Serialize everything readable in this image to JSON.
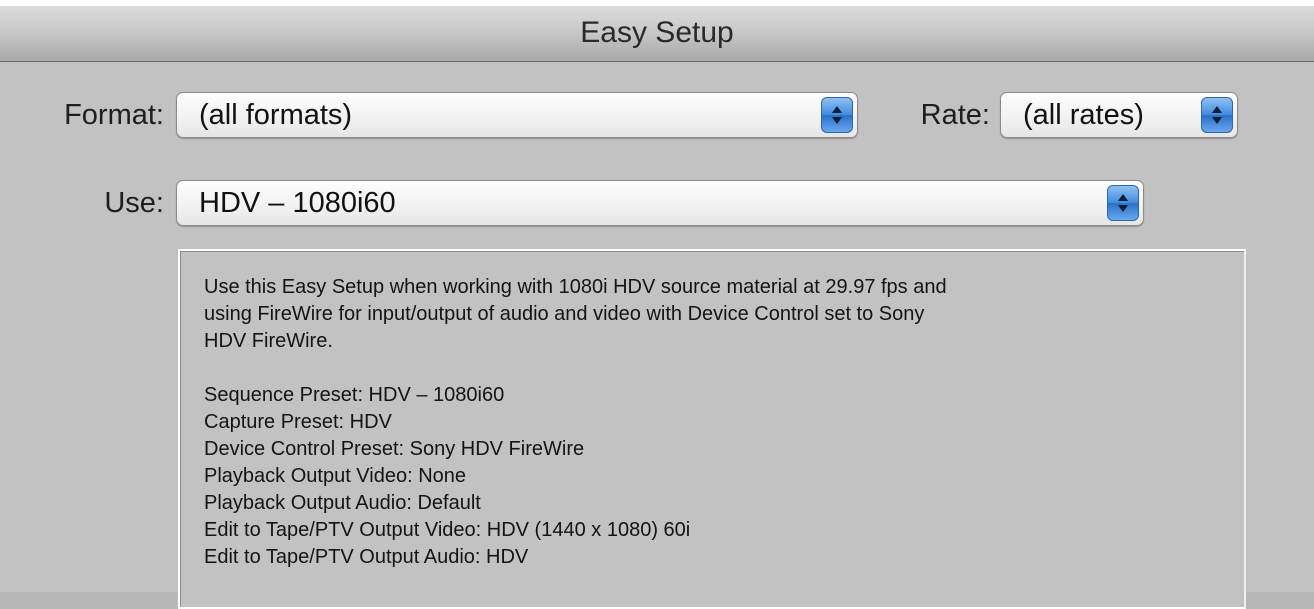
{
  "window": {
    "title": "Easy Setup"
  },
  "format": {
    "label": "Format:",
    "value": "(all formats)"
  },
  "rate": {
    "label": "Rate:",
    "value": "(all rates)"
  },
  "use": {
    "label": "Use:",
    "value": "HDV – 1080i60"
  },
  "description": {
    "summary_lines": [
      "Use this Easy Setup when working with 1080i HDV source material at 29.97 fps and",
      "using FireWire for input/output of audio and video with Device Control set to Sony",
      "HDV FireWire."
    ],
    "details": [
      "Sequence Preset: HDV – 1080i60",
      "Capture Preset: HDV",
      "Device Control Preset: Sony HDV FireWire",
      "Playback Output Video: None",
      "Playback Output Audio: Default",
      "Edit to Tape/PTV Output Video: HDV (1440 x 1080) 60i",
      "Edit to Tape/PTV Output Audio: HDV"
    ]
  },
  "colors": {
    "window_bg": "#c2c2c2",
    "titlebar_gradient_top": "#dcdcdc",
    "titlebar_gradient_bottom": "#a9a9a9",
    "stepper_blue": "#3f8be0"
  },
  "icons": {
    "popup_stepper": "up-down-arrows-icon"
  }
}
